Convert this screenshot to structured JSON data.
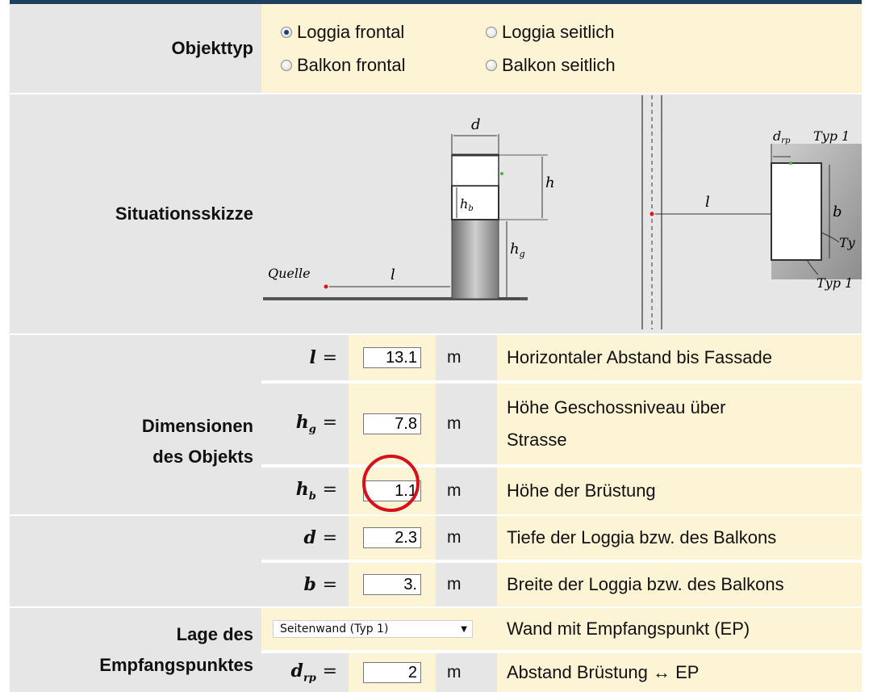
{
  "objekttyp": {
    "label": "Objekttyp",
    "options": [
      {
        "label": "Loggia frontal",
        "selected": true
      },
      {
        "label": "Loggia seitlich",
        "selected": false
      },
      {
        "label": "Balkon frontal",
        "selected": false
      },
      {
        "label": "Balkon seitlich",
        "selected": false
      }
    ]
  },
  "situation": {
    "label": "Situationsskizze",
    "sketch": {
      "d": "d",
      "h": "h",
      "hb": "h",
      "hb_sub": "b",
      "hg": "h",
      "hg_sub": "g",
      "l": "l",
      "quelle": "Quelle",
      "b": "b",
      "drp": "d",
      "drp_sub": "rp",
      "typ1_top": "Typ 1",
      "typ1_bottom": "Typ 1",
      "ty": "Ty"
    }
  },
  "dimensionen": {
    "label_line1": "Dimensionen",
    "label_line2": "des Objekts",
    "rows": [
      {
        "var": "l",
        "sub": "",
        "value": "13.1",
        "unit": "m",
        "desc": "Horizontaler Abstand bis Fassade"
      },
      {
        "var": "h",
        "sub": "g",
        "value": "7.8",
        "unit": "m",
        "desc_line1": "Höhe Geschossniveau über",
        "desc_line2": "Strasse"
      },
      {
        "var": "h",
        "sub": "b",
        "value": "1.1",
        "unit": "m",
        "desc": "Höhe der Brüstung"
      },
      {
        "var": "d",
        "sub": "",
        "value": "2.3",
        "unit": "m",
        "desc": "Tiefe der Loggia bzw. des Balkons"
      },
      {
        "var": "b",
        "sub": "",
        "value": "3.",
        "unit": "m",
        "desc": "Breite der Loggia bzw. des Balkons"
      }
    ]
  },
  "lage": {
    "label_line1": "Lage des",
    "label_line2": "Empfangspunktes",
    "select_value": "Seitenwand (Typ 1)",
    "select_desc": "Wand mit Empfangspunkt (EP)",
    "var": "d",
    "sub": "rp",
    "value": "2",
    "unit": "m",
    "desc": "Abstand Brüstung ↔ EP"
  },
  "equals": "=",
  "colors": {
    "label_bg": "#e6e6e6",
    "cream_bg": "#fdf3d5",
    "highlight_circle": "#d8101a",
    "top_bar": "#1f3f5f"
  }
}
